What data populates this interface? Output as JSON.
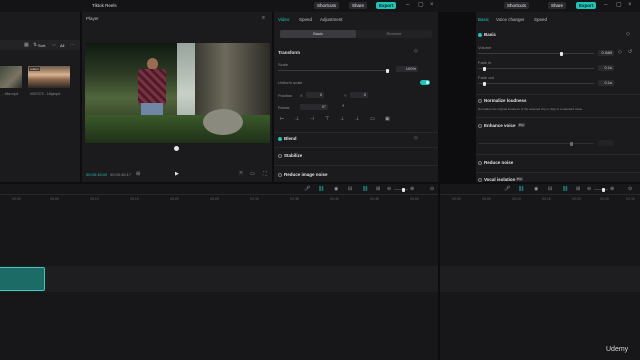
{
  "left_window": {
    "title": "Tiktok Reels",
    "shortcuts": "Shortcuts",
    "share": "Share",
    "export": "Export",
    "media": {
      "sort_label": "Sort",
      "all_label": "All",
      "thumbnails": [
        {
          "caption": "...0bs.mp4"
        },
        {
          "caption": "0007073 - 1Mpmp4"
        }
      ],
      "thumb_badge": "Added"
    },
    "player": {
      "label": "Player",
      "time_current": "00:00:15:00",
      "time_total": "00:00:46:17"
    },
    "inspector": {
      "tabs": [
        "Video",
        "Speed",
        "Adjustment"
      ],
      "subtabs": [
        "Basic",
        "Remove"
      ],
      "transform_title": "Transform",
      "scale_label": "Scale",
      "scale_value": "100%",
      "uniform_scale_label": "Uniform scale",
      "position_label": "Position",
      "position_x_label": "X",
      "position_x": "0",
      "position_y_label": "Y",
      "position_y": "0",
      "rotate_label": "Rotate",
      "rotate_value": "0°",
      "blend_label": "Blend",
      "stabilize_label": "Stabilize",
      "reduce_noise_label": "Reduce image noise"
    },
    "timeline": {
      "ticks": [
        "00:00",
        "00:05",
        "00:10",
        "00:15",
        "00:20",
        "00:25",
        "00:30",
        "00:35",
        "00:40",
        "00:45",
        "00:50"
      ]
    }
  },
  "right_window": {
    "shortcuts": "Shortcuts",
    "share": "Share",
    "export": "Export",
    "tabs": [
      "Basic",
      "Voice changer",
      "Speed"
    ],
    "basic_title": "Basic",
    "volume_label": "Volume",
    "volume_value": "0.0dB",
    "volume_level_percent": 72,
    "fade_in_label": "Fade in",
    "fade_in_value": "0.1s",
    "fade_out_label": "Fade out",
    "fade_out_value": "0.1s",
    "normalize_label": "Normalize loudness",
    "normalize_desc": "Normalize the original loudness of the selected clip or clips to a standard value",
    "enhance_label": "Enhance voice",
    "enhance_badge": "Pro",
    "reduce_noise_label": "Reduce noise",
    "vocal_isolation_label": "Vocal isolation",
    "vocal_isolation_badge": "Pro",
    "timeline_ticks": [
      "00:00",
      "00:05",
      "00:10",
      "00:15",
      "00:20",
      "00:25",
      "00:30"
    ]
  },
  "watermark": "Udemy",
  "colors": {
    "accent": "#1fc4b6",
    "clip": "#1c6b66",
    "panel": "#1b1b1e"
  }
}
